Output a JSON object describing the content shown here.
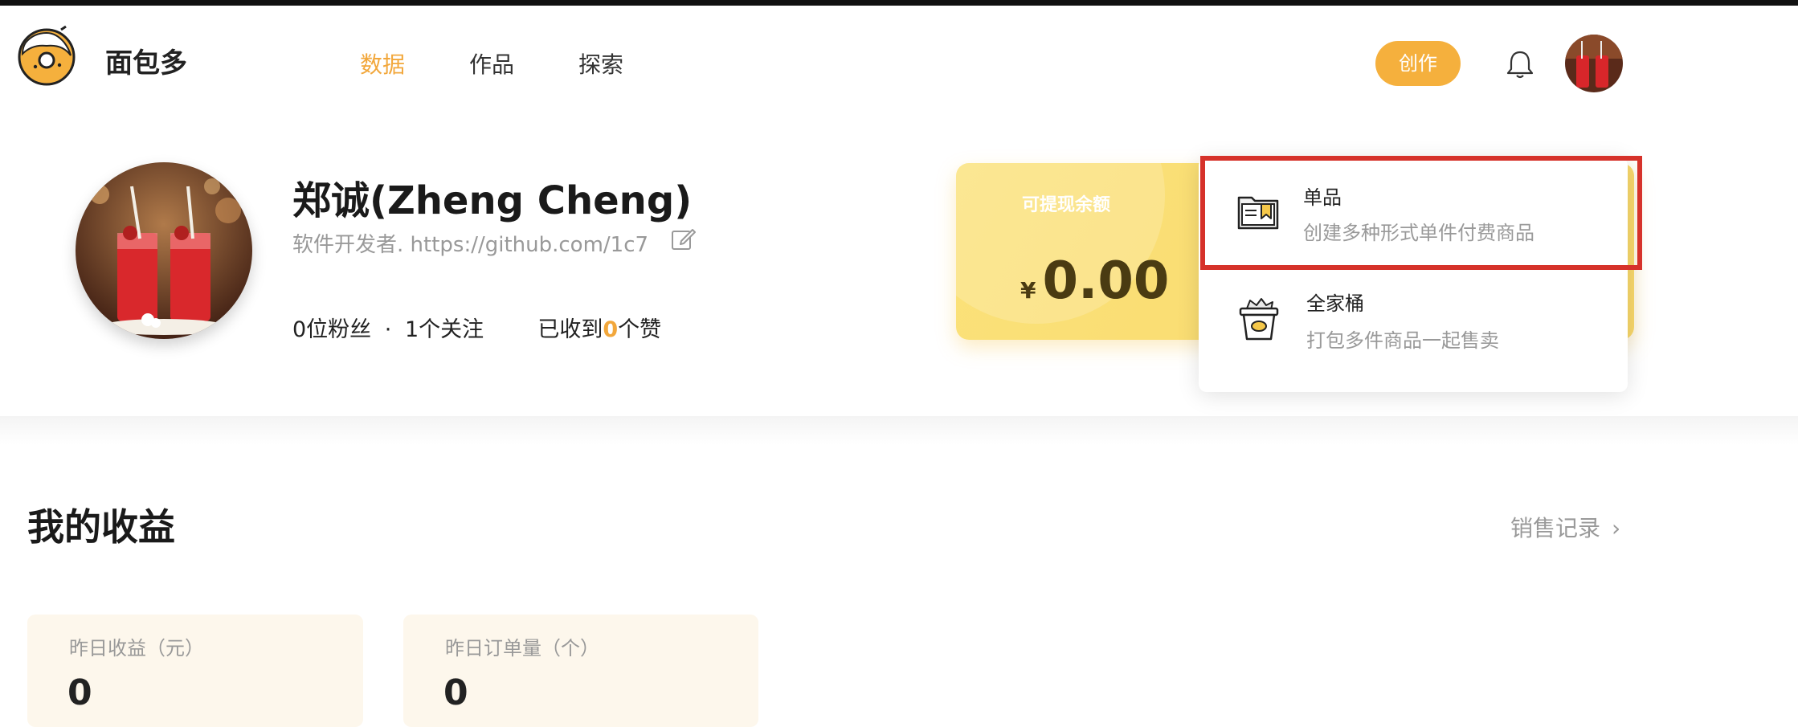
{
  "header": {
    "brand": "面包多",
    "nav": [
      {
        "label": "数据",
        "active": true
      },
      {
        "label": "作品",
        "active": false
      },
      {
        "label": "探索",
        "active": false
      }
    ],
    "create_label": "创作",
    "accent_color": "#f5b03d"
  },
  "profile": {
    "name": "郑诚(Zheng Cheng)",
    "bio": "软件开发者. https://github.com/1c7",
    "followers_text": "0位粉丝",
    "separator": "·",
    "following_text": "1个关注",
    "likes_prefix": "已收到",
    "likes_count": "0",
    "likes_suffix": "个赞"
  },
  "balance": {
    "label": "可提现余额",
    "currency": "¥",
    "amount": "0.00"
  },
  "dropdown": {
    "items": [
      {
        "title": "单品",
        "desc": "创建多种形式单件付费商品",
        "icon": "single-item-icon"
      },
      {
        "title": "全家桶",
        "desc": "打包多件商品一起售卖",
        "icon": "bundle-bucket-icon"
      }
    ],
    "highlight_color": "#d6322a"
  },
  "earnings": {
    "title": "我的收益",
    "sales_link": "销售记录",
    "cards": [
      {
        "label": "昨日收益（元）",
        "value": "0"
      },
      {
        "label": "昨日订单量（个）",
        "value": "0"
      }
    ]
  }
}
